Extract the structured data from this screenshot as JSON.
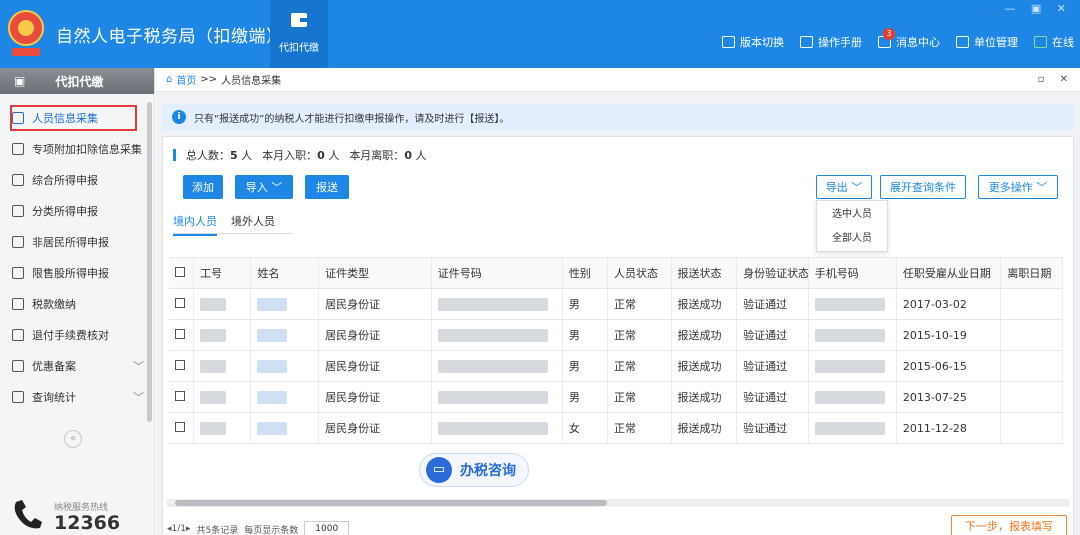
{
  "app": {
    "title": "自然人电子税务局（扣缴端）",
    "module_tab": "代扣代缴",
    "window_controls": "— ▣ ✕"
  },
  "top_links": [
    {
      "label": "版本切换",
      "icon": "switch-icon"
    },
    {
      "label": "操作手册",
      "icon": "manual-icon"
    },
    {
      "label": "消息中心",
      "icon": "mail-icon",
      "badge": "3"
    },
    {
      "label": "单位管理",
      "icon": "org-icon"
    },
    {
      "label": "在线",
      "icon": "online-icon"
    }
  ],
  "sidebar": {
    "header": "代扣代缴",
    "items": [
      {
        "label": "人员信息采集",
        "icon": "person-icon",
        "active": true
      },
      {
        "label": "专项附加扣除信息采集",
        "icon": "list-icon"
      },
      {
        "label": "综合所得申报",
        "icon": "layers-icon"
      },
      {
        "label": "分类所得申报",
        "icon": "clock-icon"
      },
      {
        "label": "非居民所得申报",
        "icon": "user-icon"
      },
      {
        "label": "限售股所得申报",
        "icon": "chart-icon"
      },
      {
        "label": "税款缴纳",
        "icon": "wallet-icon"
      },
      {
        "label": "退付手续费核对",
        "icon": "check-icon"
      },
      {
        "label": "优惠备案",
        "icon": "doc-icon",
        "expandable": true
      },
      {
        "label": "查询统计",
        "icon": "search-icon",
        "expandable": true
      }
    ],
    "collapse": "«",
    "hotline_caption": "纳税服务热线",
    "hotline_number": "12366"
  },
  "breadcrumb": {
    "home": "首页",
    "sep": ">>",
    "current": "人员信息采集",
    "controls": "▫ ✕"
  },
  "notice": {
    "icon": "i",
    "text": "只有“报送成功”的纳税人才能进行扣缴申报操作，请及时进行【报送】。"
  },
  "summary": {
    "total_label": "总人数：",
    "total": "5",
    "total_unit": "人",
    "in_label": "本月入职：",
    "in": "0",
    "in_unit": "人",
    "out_label": "本月离职：",
    "out": "0",
    "out_unit": "人"
  },
  "buttons": {
    "add": "添加",
    "import": "导入 ﹀",
    "submit": "报送",
    "export": "导出 ﹀",
    "expand_query": "展开查询条件",
    "more": "更多操作 ﹀"
  },
  "export_menu": [
    "选中人员",
    "全部人员"
  ],
  "tabs": [
    "境内人员",
    "境外人员"
  ],
  "table": {
    "headers": [
      "工号",
      "姓名",
      "证件类型",
      "证件号码",
      "性别",
      "人员状态",
      "报送状态",
      "身份验证状态",
      "手机号码",
      "任职受雇从业日期",
      "离职日期"
    ],
    "rows": [
      {
        "idtype": "居民身份证",
        "gender": "男",
        "status": "正常",
        "report": "报送成功",
        "verify": "验证通过",
        "date": "2017-03-02"
      },
      {
        "idtype": "居民身份证",
        "gender": "男",
        "status": "正常",
        "report": "报送成功",
        "verify": "验证通过",
        "date": "2015-10-19"
      },
      {
        "idtype": "居民身份证",
        "gender": "男",
        "status": "正常",
        "report": "报送成功",
        "verify": "验证通过",
        "date": "2015-06-15"
      },
      {
        "idtype": "居民身份证",
        "gender": "男",
        "status": "正常",
        "report": "报送成功",
        "verify": "验证通过",
        "date": "2013-07-25"
      },
      {
        "idtype": "居民身份证",
        "gender": "女",
        "status": "正常",
        "report": "报送成功",
        "verify": "验证通过",
        "date": "2011-12-28"
      }
    ]
  },
  "consult": {
    "label": "办税咨询",
    "icon": "chat-icon"
  },
  "pager": {
    "nav": "◂1/1▸",
    "total_text": "共5条记录",
    "per_page_label": "每页显示条数",
    "per_page": "1000"
  },
  "next_button": "下一步，报表填写",
  "colors": {
    "brand": "#1e87e6",
    "highlight_border": "#e23b3b",
    "next": "#f0741a"
  }
}
